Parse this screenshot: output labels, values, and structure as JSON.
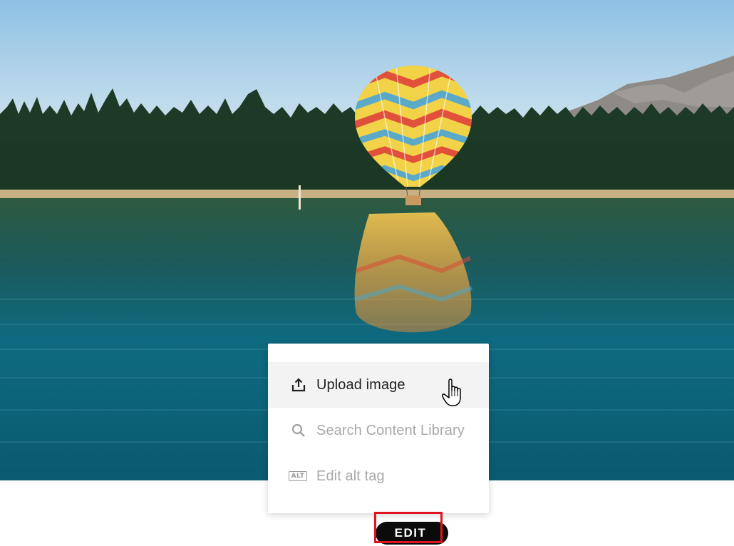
{
  "image": {
    "subject": "hot-air-balloon-over-lake",
    "colors": {
      "sky": "#a9cde6",
      "forest": "#1f3d29",
      "water": "#0f6274",
      "sand": "#c9b48a"
    }
  },
  "menu": {
    "items": [
      {
        "icon": "upload-icon",
        "label": "Upload image",
        "state": "hover"
      },
      {
        "icon": "search-icon",
        "label": "Search Content Library",
        "state": "disabled"
      },
      {
        "icon": "alt-tag-icon",
        "badge": "ALT",
        "label": "Edit alt tag",
        "state": "disabled"
      }
    ]
  },
  "edit_button": {
    "label": "EDIT",
    "highlight_color": "#e0141e"
  }
}
